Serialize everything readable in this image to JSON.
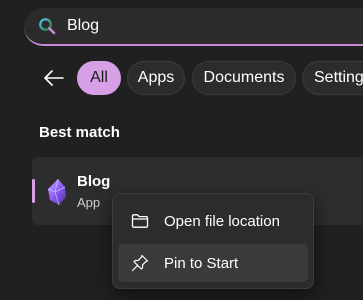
{
  "search": {
    "query": "Blog"
  },
  "filters": [
    {
      "label": "All",
      "active": true
    },
    {
      "label": "Apps"
    },
    {
      "label": "Documents"
    },
    {
      "label": "Setting"
    }
  ],
  "best_match": {
    "heading": "Best match",
    "title": "Blog",
    "subtitle": "App",
    "icon": "obsidian-crystal-icon"
  },
  "context_menu": {
    "items": [
      {
        "label": "Open file location",
        "icon": "folder-icon"
      },
      {
        "label": "Pin to Start",
        "icon": "pin-icon"
      }
    ]
  },
  "colors": {
    "accent": "#d69fe6",
    "background": "#202020",
    "surface": "#2d2d2d",
    "menu": "#2c2c2c"
  }
}
